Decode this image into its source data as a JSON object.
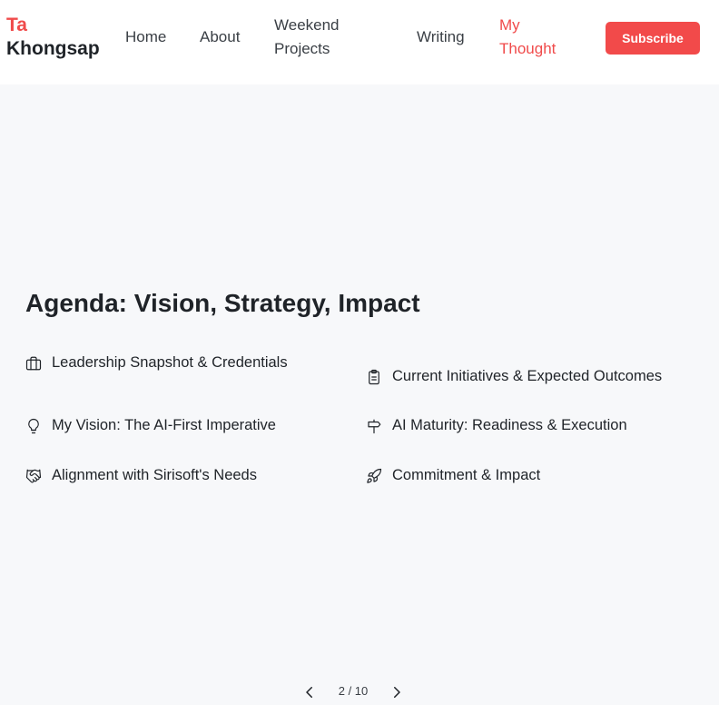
{
  "header": {
    "brand_first": "Ta",
    "brand_last": "Khongsap",
    "nav": [
      {
        "label": "Home",
        "active": false
      },
      {
        "label": "About",
        "active": false
      },
      {
        "label": "Weekend Projects",
        "active": false
      },
      {
        "label": "Writing",
        "active": false
      },
      {
        "label": "My Thought",
        "active": true
      }
    ],
    "subscribe_label": "Subscribe"
  },
  "slide": {
    "title": "Agenda: Vision, Strategy, Impact",
    "items": [
      {
        "label": "Leadership Snapshot & Credentials",
        "icon": "briefcase-icon"
      },
      {
        "label": "Current Initiatives & Expected Outcomes",
        "icon": "clipboard-icon"
      },
      {
        "label": "My Vision: The AI-First Imperative",
        "icon": "lightbulb-icon"
      },
      {
        "label": "AI Maturity: Readiness & Execution",
        "icon": "signpost-icon"
      },
      {
        "label": "Alignment with Sirisoft's Needs",
        "icon": "handshake-icon"
      },
      {
        "label": "Commitment & Impact",
        "icon": "rocket-icon"
      }
    ]
  },
  "pager": {
    "current": 2,
    "total": 10,
    "label": "2 / 10"
  },
  "colors": {
    "accent": "#f04b4b",
    "background": "#f7f8fa",
    "header_bg": "#ffffff",
    "text": "#1f2328"
  }
}
